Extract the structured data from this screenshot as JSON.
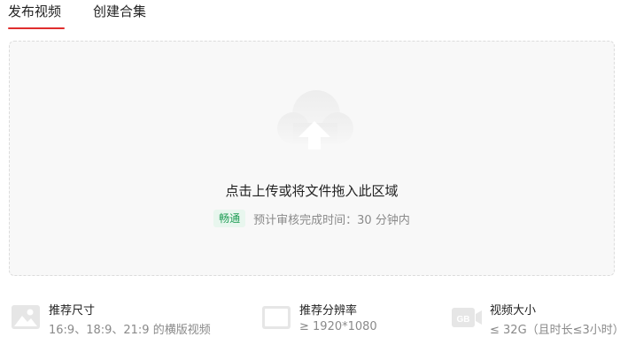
{
  "tabs": {
    "publish_video": "发布视频",
    "create_collection": "创建合集",
    "active_color": "#e02e2e"
  },
  "dropzone": {
    "title": "点击上传或将文件拖入此区域",
    "badge": "畅通",
    "review_text": "预计审核完成时间：30 分钟内",
    "icon": "cloud-upload-icon"
  },
  "requirements": [
    {
      "icon": "image-icon",
      "title": "推荐尺寸",
      "desc": "16:9、18:9、21:9 的横版视频"
    },
    {
      "icon": "screen-icon",
      "title": "推荐分辨率",
      "desc": "≥ 1920*1080"
    },
    {
      "icon": "video-size-icon",
      "badge": "GB",
      "title": "视频大小",
      "desc": "≤ 32G（且时长≤3小时）"
    }
  ]
}
